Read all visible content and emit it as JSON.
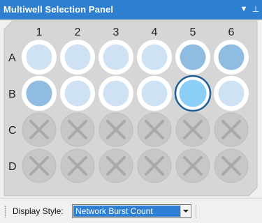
{
  "panel": {
    "title": "Multiwell Selection Panel",
    "menu_glyph": "▼",
    "pin_glyph": "⊥"
  },
  "plate": {
    "columns": [
      "1",
      "2",
      "3",
      "4",
      "5",
      "6"
    ],
    "rows": [
      "A",
      "B",
      "C",
      "D"
    ],
    "wells": [
      [
        "light",
        "light",
        "light",
        "light",
        "medium",
        "medium"
      ],
      [
        "medium",
        "light",
        "light",
        "light",
        "selected",
        "light"
      ],
      [
        "disabled",
        "disabled",
        "disabled",
        "disabled",
        "disabled",
        "disabled"
      ],
      [
        "disabled",
        "disabled",
        "disabled",
        "disabled",
        "disabled",
        "disabled"
      ]
    ],
    "colors": {
      "plate_fill": "#d6d6d6",
      "well_ring": "#ffffff",
      "light": "#cfe2f3",
      "medium": "#8fbce0",
      "selected": "#8ccff6",
      "selected_border": "#1f5f99",
      "disabled": "#c7c7c7",
      "disabled_x": "#a9a9a9"
    }
  },
  "toolbar": {
    "display_style_label": "Display Style:",
    "display_style_value": "Network Burst Count"
  }
}
